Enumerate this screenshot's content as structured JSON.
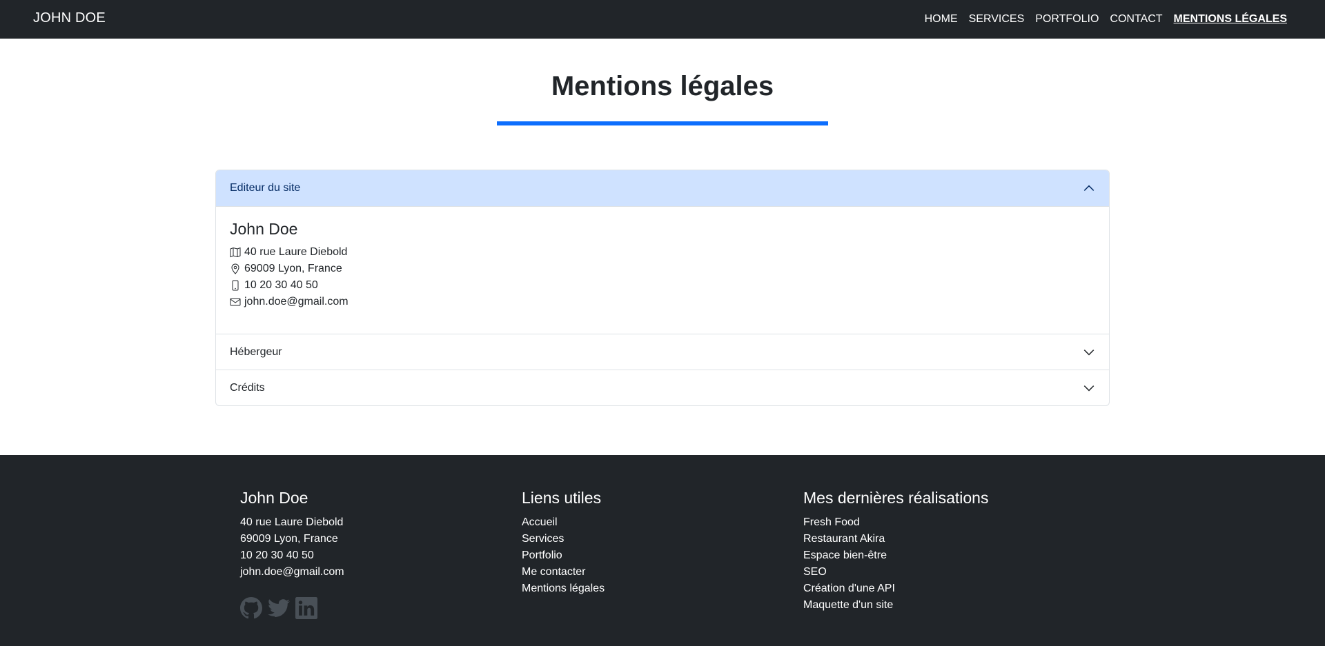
{
  "navbar": {
    "brand": "JOHN DOE",
    "links": [
      {
        "label": "HOME"
      },
      {
        "label": "SERVICES"
      },
      {
        "label": "PORTFOLIO"
      },
      {
        "label": "CONTACT"
      },
      {
        "label": "MENTIONS LÉGALES",
        "active": true
      }
    ]
  },
  "page": {
    "title": "Mentions légales",
    "accent_color": "#0d6efd"
  },
  "accordion": {
    "sections": [
      {
        "label": "Editeur du site",
        "expanded": true,
        "body": {
          "name": "John Doe",
          "lines": [
            {
              "icon": "map-icon",
              "text": "40 rue Laure Diebold"
            },
            {
              "icon": "geo-pin-icon",
              "text": "69009 Lyon, France"
            },
            {
              "icon": "phone-icon",
              "text": "10 20 30 40 50"
            },
            {
              "icon": "envelope-icon",
              "text": "john.doe@gmail.com"
            }
          ]
        }
      },
      {
        "label": "Hébergeur",
        "expanded": false
      },
      {
        "label": "Crédits",
        "expanded": false
      }
    ]
  },
  "footer": {
    "contact": {
      "title": "John Doe",
      "lines": [
        "40 rue Laure Diebold",
        "69009 Lyon, France",
        "10 20 30 40 50",
        "john.doe@gmail.com"
      ],
      "social_icons": [
        "github-icon",
        "twitter-icon",
        "linkedin-icon"
      ]
    },
    "useful_links": {
      "title": "Liens utiles",
      "links": [
        "Accueil",
        "Services",
        "Portfolio",
        "Me contacter",
        "Mentions légales"
      ]
    },
    "latest_work": {
      "title": "Mes dernières réalisations",
      "links": [
        "Fresh Food",
        "Restaurant Akira",
        "Espace bien-être",
        "SEO",
        "Création d'une API",
        "Maquette d'un site"
      ]
    }
  }
}
